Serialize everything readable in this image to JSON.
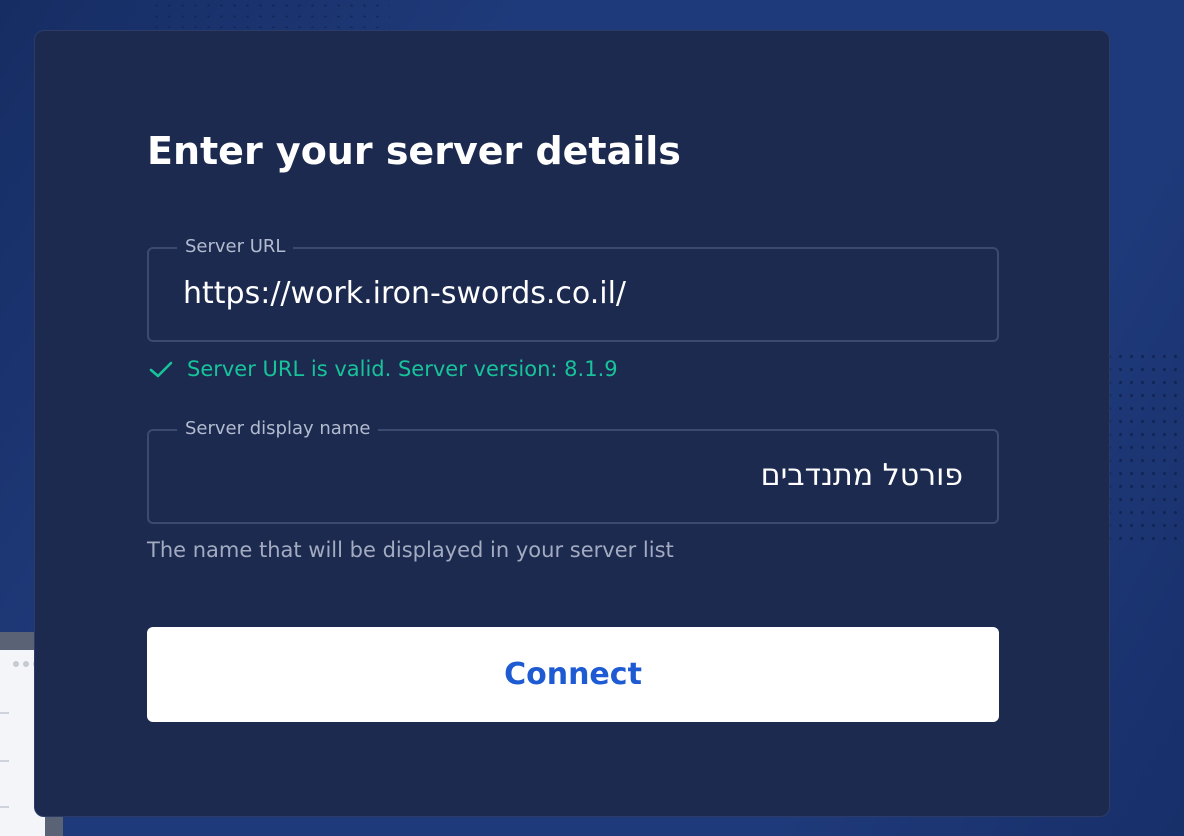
{
  "form": {
    "title": "Enter your server details",
    "url_field": {
      "label": "Server URL",
      "value": "https://work.iron-swords.co.il/"
    },
    "validation": {
      "icon": "check-icon",
      "message": "Server URL is valid. Server version: 8.1.9"
    },
    "name_field": {
      "label": "Server display name",
      "value": "פורטל מתנדבים"
    },
    "name_helper": "The name that will be displayed in your server list",
    "connect_label": "Connect"
  },
  "colors": {
    "background": "#1f3a7a",
    "card": "#1c2a50",
    "success": "#18c39a",
    "button_text": "#1e5bd2",
    "button_bg": "#ffffff"
  }
}
